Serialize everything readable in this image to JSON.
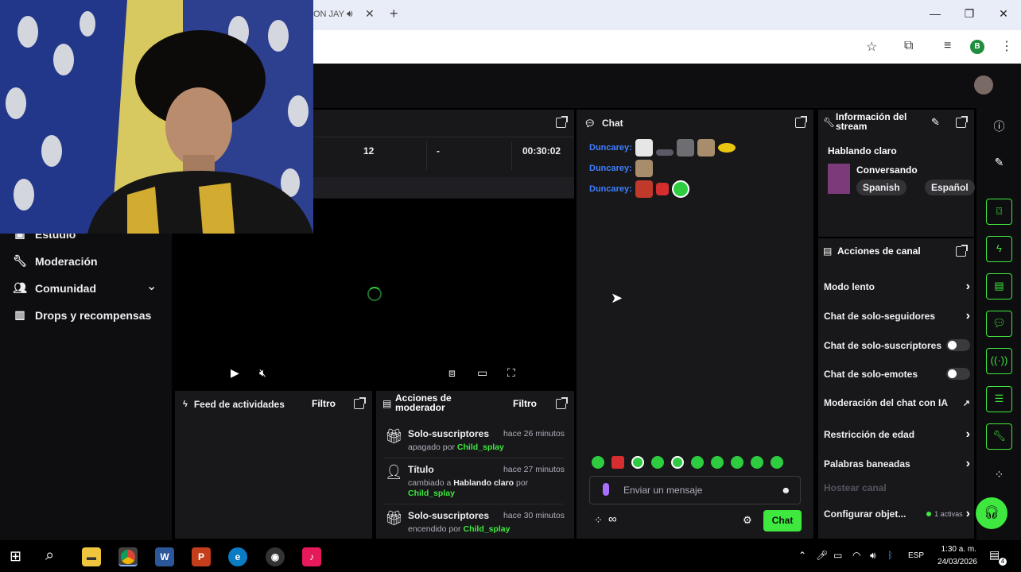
{
  "browser": {
    "tab_partial_title": "ON JAY",
    "profile_initial": "B"
  },
  "sidebar": {
    "items": [
      {
        "label": "Estudio",
        "icon": "camera-icon"
      },
      {
        "label": "Moderación",
        "icon": "wrench-icon"
      },
      {
        "label": "Comunidad",
        "icon": "people-icon"
      },
      {
        "label": "Drops y recompensas",
        "icon": "gift-icon"
      }
    ]
  },
  "stats": {
    "viewers": "12",
    "followers": "-",
    "uptime": "00:30:02"
  },
  "chat": {
    "title": "Chat",
    "lines": [
      {
        "user": "Duncarey:"
      },
      {
        "user": "Duncarey:"
      },
      {
        "user": "Duncarey:"
      }
    ],
    "input_placeholder": "Enviar un mensaje",
    "send_label": "Chat",
    "points_symbol": "∞"
  },
  "stream_info": {
    "title": "Información del stream",
    "stream_title": "Hablando claro",
    "category": "Conversando",
    "tags": [
      "Spanish",
      "Español"
    ]
  },
  "channel_actions": {
    "title": "Acciones de canal",
    "items": [
      {
        "label": "Modo lento",
        "control": "chevron"
      },
      {
        "label": "Chat de solo-seguidores",
        "control": "chevron"
      },
      {
        "label": "Chat de solo-suscriptores",
        "control": "toggle",
        "on": false
      },
      {
        "label": "Chat de solo-emotes",
        "control": "toggle",
        "on": false
      },
      {
        "label": "Moderación del chat con IA",
        "control": "external"
      },
      {
        "label": "Restricción de edad",
        "control": "chevron"
      },
      {
        "label": "Palabras baneadas",
        "control": "chevron"
      },
      {
        "label": "Hostear canal",
        "control": "disabled"
      },
      {
        "label": "Configurar objet...",
        "control": "chevron",
        "badge": "1 activas"
      }
    ]
  },
  "activity_feed": {
    "title": "Feed de actividades",
    "filter": "Filtro"
  },
  "mod_actions": {
    "title": "Acciones de moderador",
    "filter": "Filtro",
    "items": [
      {
        "title": "Solo-suscriptores",
        "time": "hace 26 minutos",
        "desc_prefix": "apagado por",
        "value": "",
        "by": "Child_splay"
      },
      {
        "title": "Título",
        "time": "hace 27 minutos",
        "desc_prefix": "cambiado a",
        "value": "Hablando claro",
        "by_prefix": "por",
        "by": "Child_splay"
      },
      {
        "title": "Solo-suscriptores",
        "time": "hace 30 minutos",
        "desc_prefix": "encendido por",
        "value": "",
        "by": "Child_splay"
      }
    ]
  },
  "taskbar": {
    "lang": "ESP",
    "time": "1:30 a. m.",
    "date": "24/03/2026",
    "notif_count": "4"
  },
  "colors": {
    "accent": "#3ee83e",
    "username": "#3f7eff",
    "panel": "#18181b",
    "bg": "#0e0e10"
  }
}
